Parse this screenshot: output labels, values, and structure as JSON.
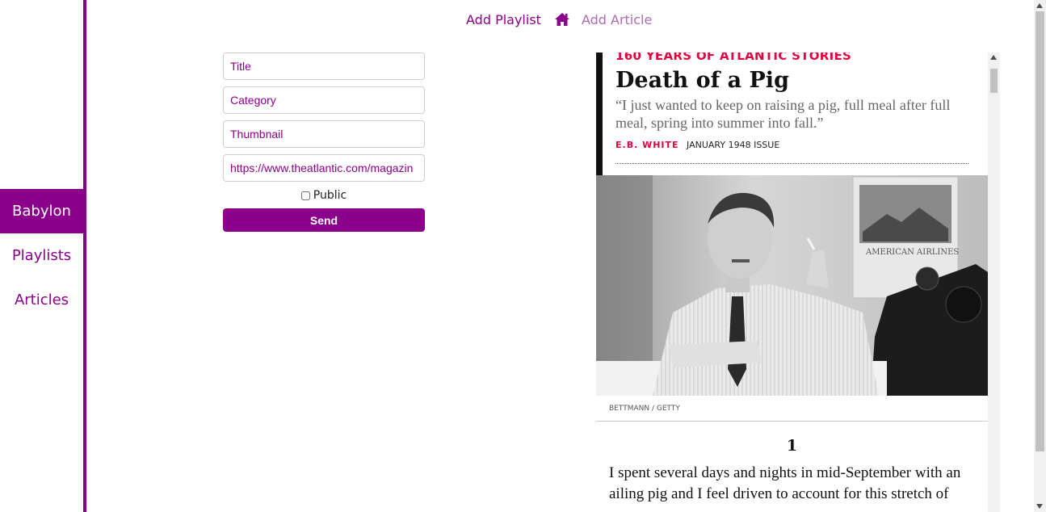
{
  "sidebar": {
    "items": [
      {
        "label": "Babylon"
      },
      {
        "label": "Playlists"
      },
      {
        "label": "Articles"
      }
    ]
  },
  "topnav": {
    "add_playlist": "Add Playlist",
    "home_icon": "home-icon",
    "add_article": "Add Article"
  },
  "form": {
    "title_placeholder": "Title",
    "category_placeholder": "Category",
    "thumbnail_placeholder": "Thumbnail",
    "url_value": "https://www.theatlantic.com/magazin",
    "public_label": "Public",
    "public_checked": false,
    "send_label": "Send"
  },
  "preview": {
    "kicker": "160 YEARS OF ATLANTIC STORIES",
    "headline": "Death of a Pig",
    "dek": "“I just wanted to keep on raising a pig, full meal after full meal, spring into summer into fall.”",
    "author": "E.B. WHITE",
    "issue": "JANUARY 1948 ISSUE",
    "photo_sign": "AMERICAN AIRLINES",
    "photo_credit": "BETTMANN / GETTY",
    "section_number": "1",
    "body": "I spent several days and nights in mid-September with an ailing pig and I feel driven to account for this stretch of"
  },
  "colors": {
    "accent": "#8b008b",
    "kicker_red": "#e3003f"
  }
}
